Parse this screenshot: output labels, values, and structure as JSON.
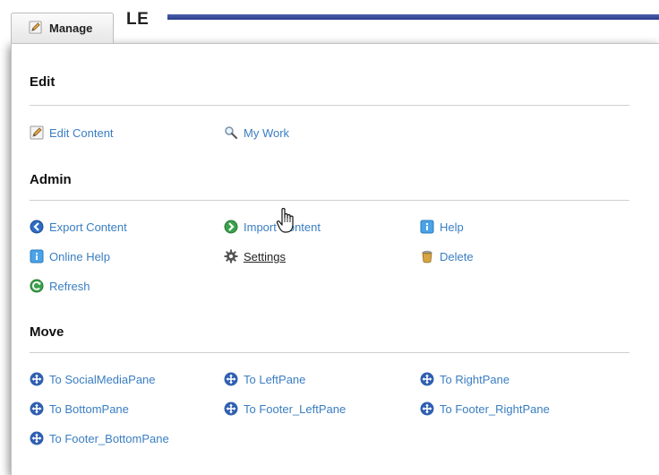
{
  "header": {
    "title_fragment": "LE",
    "manage_tab_label": "Manage"
  },
  "sections": {
    "edit": {
      "title": "Edit",
      "items": [
        {
          "label": "Edit Content",
          "icon": "edit-pencil-icon"
        },
        {
          "label": "My Work",
          "icon": "magnifier-icon"
        }
      ]
    },
    "admin": {
      "title": "Admin",
      "items": [
        {
          "label": "Export Content",
          "icon": "export-arrow-icon"
        },
        {
          "label": "Import Content",
          "icon": "import-arrow-icon"
        },
        {
          "label": "Help",
          "icon": "help-icon"
        },
        {
          "label": "Online Help",
          "icon": "online-help-icon"
        },
        {
          "label": "Settings",
          "icon": "gear-icon"
        },
        {
          "label": "Delete",
          "icon": "trash-icon"
        },
        {
          "label": "Refresh",
          "icon": "refresh-icon"
        }
      ]
    },
    "move": {
      "title": "Move",
      "items": [
        {
          "label": "To SocialMediaPane",
          "icon": "move-arrows-icon"
        },
        {
          "label": "To LeftPane",
          "icon": "move-arrows-icon"
        },
        {
          "label": "To RightPane",
          "icon": "move-arrows-icon"
        },
        {
          "label": "To BottomPane",
          "icon": "move-arrows-icon"
        },
        {
          "label": "To Footer_LeftPane",
          "icon": "move-arrows-icon"
        },
        {
          "label": "To Footer_RightPane",
          "icon": "move-arrows-icon"
        },
        {
          "label": "To Footer_BottomPane",
          "icon": "move-arrows-icon"
        }
      ]
    }
  },
  "colors": {
    "link": "#3a7ec2",
    "title_bar": "#2b3e8f",
    "move_icon": "#2f5fb0"
  }
}
